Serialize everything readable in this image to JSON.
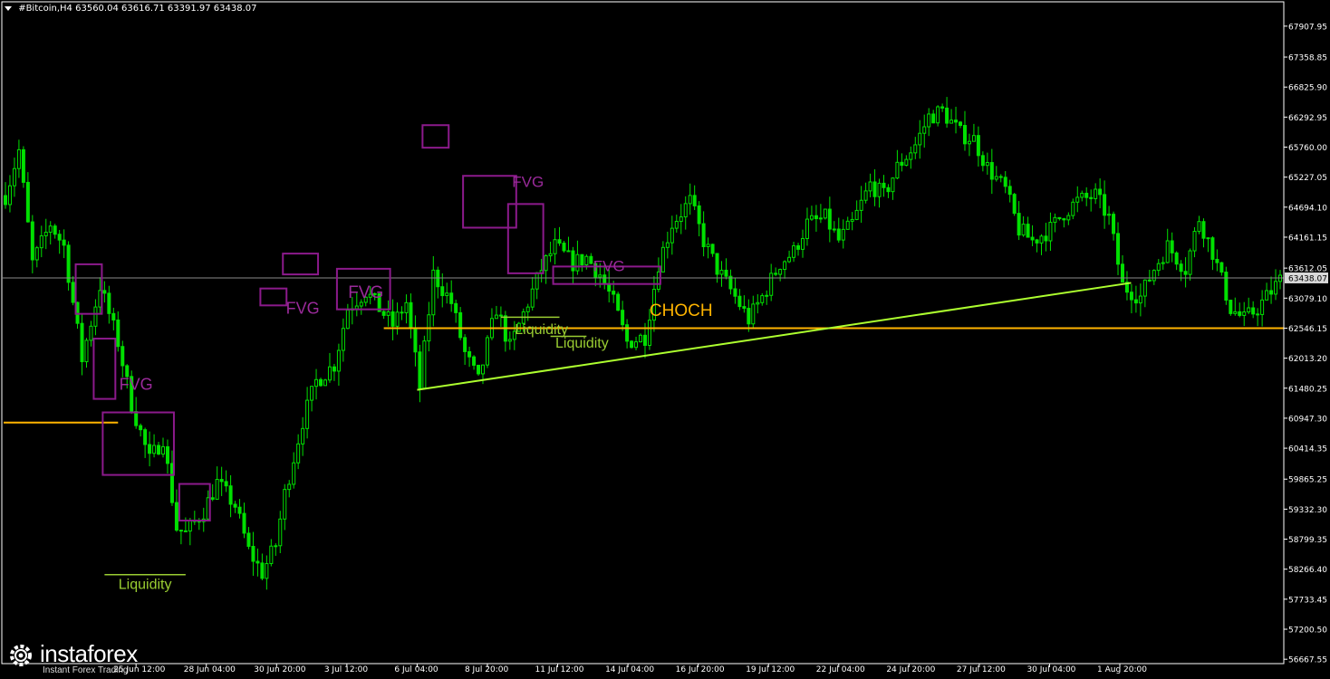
{
  "header": {
    "symbol": "#Bitcoin,H4",
    "ohlc": "63560.04 63616.71 63391.97 63438.07"
  },
  "current_price_label": "63438.07",
  "logo": {
    "name": "instaforex",
    "tagline": "Instant Forex Trading"
  },
  "colors": {
    "background": "#000000",
    "candle": "#00e000",
    "fvg_box": "#8b1a8b",
    "fvg_text": "#9a2a9a",
    "liquidity": "#9acd32",
    "choch": "#ffb400",
    "axis": "#ffffff"
  },
  "chart_data": {
    "type": "candlestick",
    "y_ticks": [
      "67907.95",
      "67358.85",
      "66825.90",
      "66292.95",
      "65760.00",
      "65227.05",
      "64694.10",
      "64161.15",
      "63612.05",
      "63079.10",
      "62546.15",
      "62013.20",
      "61480.25",
      "60947.30",
      "60414.35",
      "59865.25",
      "59332.30",
      "58799.35",
      "58266.40",
      "57733.45",
      "57200.50",
      "56667.55"
    ],
    "ylim": [
      56590,
      68340
    ],
    "x_ticks": [
      "25 Jun 12:00",
      "28 Jun 04:00",
      "30 Jun 20:00",
      "3 Jul 12:00",
      "6 Jul 04:00",
      "8 Jul 20:00",
      "11 Jul 12:00",
      "14 Jul 04:00",
      "16 Jul 20:00",
      "19 Jul 12:00",
      "22 Jul 04:00",
      "24 Jul 20:00",
      "27 Jul 12:00",
      "30 Jul 04:00",
      "1 Aug 20:00"
    ],
    "current_price": 63438.07,
    "close_path": [
      [
        0,
        64900
      ],
      [
        3,
        65700
      ],
      [
        6,
        63700
      ],
      [
        10,
        64400
      ],
      [
        13,
        64000
      ],
      [
        17,
        62000
      ],
      [
        21,
        63300
      ],
      [
        25,
        62300
      ],
      [
        28,
        61200
      ],
      [
        32,
        60200
      ],
      [
        35,
        60600
      ],
      [
        38,
        59000
      ],
      [
        40,
        58900
      ],
      [
        44,
        59300
      ],
      [
        47,
        59800
      ],
      [
        51,
        59400
      ],
      [
        54,
        58600
      ],
      [
        57,
        58200
      ],
      [
        60,
        58700
      ],
      [
        62,
        59600
      ],
      [
        66,
        60900
      ],
      [
        69,
        61600
      ],
      [
        73,
        61900
      ],
      [
        76,
        62900
      ],
      [
        80,
        63200
      ],
      [
        83,
        62900
      ],
      [
        86,
        62600
      ],
      [
        89,
        63000
      ],
      [
        92,
        61500
      ],
      [
        95,
        63500
      ],
      [
        99,
        63000
      ],
      [
        102,
        62100
      ],
      [
        105,
        61600
      ],
      [
        109,
        62900
      ],
      [
        112,
        62200
      ],
      [
        116,
        63000
      ],
      [
        119,
        63600
      ],
      [
        122,
        64000
      ],
      [
        126,
        63700
      ],
      [
        129,
        63800
      ],
      [
        132,
        63500
      ],
      [
        135,
        63000
      ],
      [
        138,
        62300
      ],
      [
        142,
        62400
      ],
      [
        145,
        63700
      ],
      [
        148,
        64400
      ],
      [
        152,
        64800
      ],
      [
        155,
        64100
      ],
      [
        158,
        63600
      ],
      [
        162,
        63100
      ],
      [
        165,
        62700
      ],
      [
        168,
        63100
      ],
      [
        172,
        63700
      ],
      [
        175,
        63900
      ],
      [
        178,
        64400
      ],
      [
        182,
        64500
      ],
      [
        185,
        64100
      ],
      [
        188,
        64400
      ],
      [
        192,
        65100
      ],
      [
        195,
        64900
      ],
      [
        198,
        65400
      ],
      [
        202,
        65800
      ],
      [
        205,
        66300
      ],
      [
        208,
        66400
      ],
      [
        212,
        66000
      ],
      [
        215,
        65900
      ],
      [
        218,
        65400
      ],
      [
        222,
        65000
      ],
      [
        225,
        64300
      ],
      [
        228,
        64100
      ],
      [
        232,
        64300
      ],
      [
        235,
        64600
      ],
      [
        238,
        64800
      ],
      [
        242,
        64900
      ],
      [
        245,
        64500
      ],
      [
        248,
        63300
      ],
      [
        252,
        63100
      ],
      [
        255,
        63600
      ],
      [
        258,
        64000
      ],
      [
        262,
        63600
      ],
      [
        265,
        64500
      ],
      [
        268,
        63900
      ],
      [
        272,
        62900
      ],
      [
        275,
        62700
      ],
      [
        278,
        62900
      ],
      [
        281,
        63200
      ],
      [
        283,
        63400
      ]
    ],
    "fvg_labels": [
      "FVG",
      "FVG",
      "FVG",
      "FVG",
      "FVG"
    ],
    "liquidity_labels": [
      "Liquidity",
      "Liquidity",
      "Liquidity"
    ],
    "choch_label": "CHOCH",
    "choch_level": 62546,
    "old_level": 60870,
    "trendline": {
      "from": [
        "6 Jul 04:00",
        61450
      ],
      "to": [
        "1 Aug 20:00",
        63350
      ]
    },
    "liquidity_levels": [
      58170,
      62740,
      62400
    ],
    "fvg_zones": [
      {
        "price_top": 63680,
        "price_bottom": 62800
      },
      {
        "price_top": 62360,
        "price_bottom": 61290
      },
      {
        "price_top": 61050,
        "price_bottom": 59940
      },
      {
        "price_top": 59780,
        "price_bottom": 59130
      },
      {
        "price_top": 63250,
        "price_bottom": 62950
      },
      {
        "price_top": 63870,
        "price_bottom": 63500
      },
      {
        "price_top": 63600,
        "price_bottom": 62880
      },
      {
        "price_top": 66150,
        "price_bottom": 65750
      },
      {
        "price_top": 65250,
        "price_bottom": 64330
      },
      {
        "price_top": 64750,
        "price_bottom": 63520
      },
      {
        "price_top": 63640,
        "price_bottom": 63330
      }
    ]
  }
}
